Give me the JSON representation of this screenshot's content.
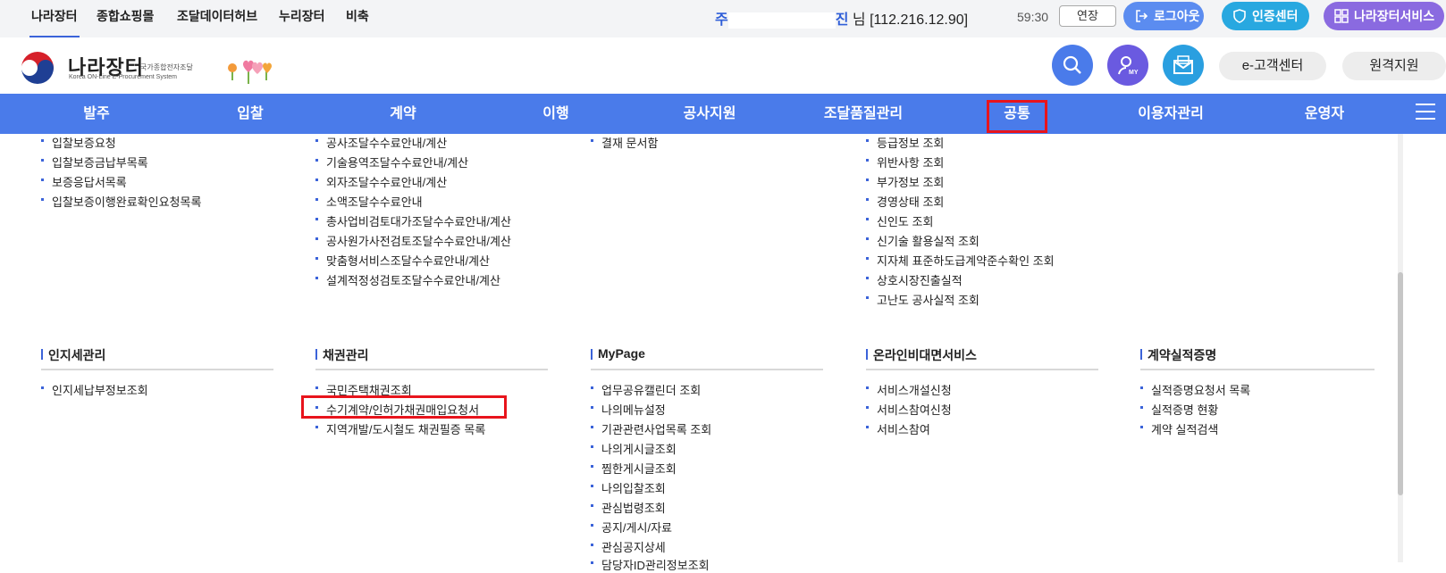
{
  "top_tabs": [
    "나라장터",
    "종합쇼핑몰",
    "조달데이터허브",
    "누리장터",
    "비축"
  ],
  "user": {
    "name_prefix": "주",
    "name_suffix": "진",
    "greeting": "님 [112.216.12.90]"
  },
  "session": {
    "timer": "59:30",
    "extend_label": "연장"
  },
  "top_buttons": {
    "logout": "로그아웃",
    "cert_center": "인증센터",
    "narajangteo_service": "나라장터서비스"
  },
  "logo": {
    "title": "나라장터",
    "sub_kr": "국가종합전자조달",
    "sub_en": "Korea ON-Line E-Procurement System"
  },
  "header_buttons": {
    "e_customer_center": "e-고객센터",
    "remote_support": "원격지원",
    "my_badge": "MY"
  },
  "nav": [
    "발주",
    "입찰",
    "계약",
    "이행",
    "공사지원",
    "조달품질관리",
    "공통",
    "이용자관리",
    "운영자"
  ],
  "upper_columns": {
    "col1": [
      "입찰보증요청",
      "입찰보증금납부목록",
      "보증응답서목록",
      "입찰보증이행완료확인요청목록"
    ],
    "col2": [
      "공사조달수수료안내/계산",
      "기술용역조달수수료안내/계산",
      "외자조달수수료안내/계산",
      "소액조달수수료안내",
      "총사업비검토대가조달수수료안내/계산",
      "공사원가사전검토조달수수료안내/계산",
      "맞춤형서비스조달수수료안내/계산",
      "설계적정성검토조달수수료안내/계산"
    ],
    "col3": [
      "결재 문서함"
    ],
    "col4": [
      "등급정보 조회",
      "위반사항 조회",
      "부가정보 조회",
      "경영상태 조회",
      "신인도 조회",
      "신기술 활용실적 조회",
      "지자체 표준하도급계약준수확인 조회",
      "상호시장진출실적",
      "고난도 공사실적 조회"
    ]
  },
  "sections": [
    {
      "title": "인지세관리",
      "items": [
        "인지세납부정보조회"
      ]
    },
    {
      "title": "채권관리",
      "items": [
        "국민주택채권조회",
        "수기계약/인허가채권매입요청서",
        "지역개발/도시철도 채권필증 목록"
      ]
    },
    {
      "title": "MyPage",
      "items": [
        "업무공유캘린더 조회",
        "나의메뉴설정",
        "기관관련사업목록 조회",
        "나의게시글조회",
        "찜한게시글조회",
        "나의입찰조회",
        "관심법령조회",
        "공지/게시/자료",
        "관심공지상세",
        "담당자ID관리정보조회"
      ]
    },
    {
      "title": "온라인비대면서비스",
      "items": [
        "서비스개설신청",
        "서비스참여신청",
        "서비스참여"
      ]
    },
    {
      "title": "계약실적증명",
      "items": [
        "실적증명요청서 목록",
        "실적증명 현황",
        "계약 실적검색"
      ]
    }
  ],
  "colors": {
    "nav_bg": "#4a7bea",
    "highlight": "#e8141c",
    "search_btn": "#4a7bea",
    "my_btn": "#6a5ae0",
    "mail_btn": "#2a9fe0",
    "logout_btn": "#5b8cf0",
    "cert_btn": "#28a8e0",
    "service_btn": "#8a6ae0"
  }
}
